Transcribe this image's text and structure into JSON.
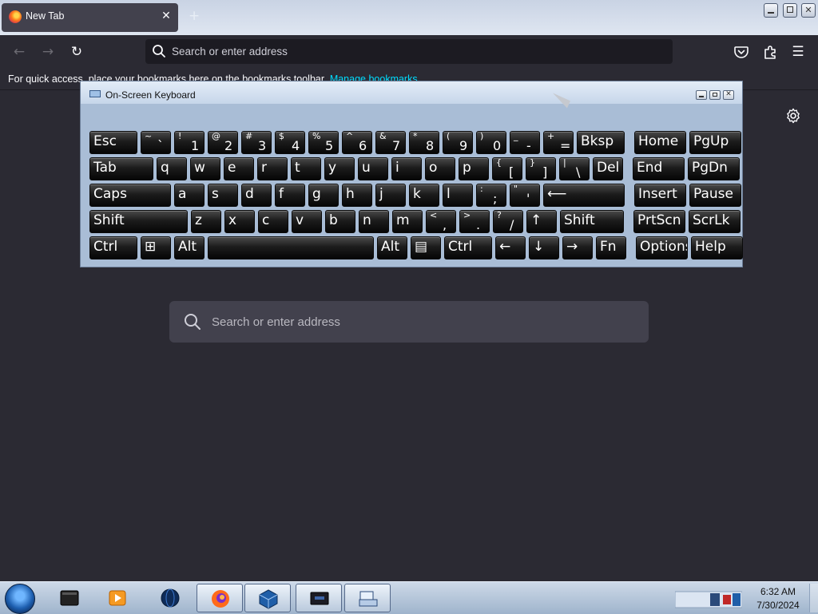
{
  "browser": {
    "tab_title": "New Tab",
    "tab_close_glyph": "✕",
    "new_tab_glyph": "+",
    "url_placeholder": "Search or enter address",
    "bookmarks_prompt": "For quick access, place your bookmarks here on the bookmarks toolbar.",
    "bookmarks_link": "Manage bookmarks",
    "back_glyph": "←",
    "forward_glyph": "→",
    "reload_glyph": "↻",
    "menu_glyph": "☰",
    "content_search_placeholder": "Search or enter address",
    "colors": {
      "background": "#2b2a33",
      "urlbar": "#1c1b22",
      "accent_link": "#00ddff"
    }
  },
  "osk": {
    "title": "On-Screen Keyboard",
    "rows": [
      [
        {
          "label": "Esc"
        },
        {
          "sub": "~",
          "main": "`"
        },
        {
          "sub": "!",
          "main": "1"
        },
        {
          "sub": "@",
          "main": "2"
        },
        {
          "sub": "#",
          "main": "3"
        },
        {
          "sub": "$",
          "main": "4"
        },
        {
          "sub": "%",
          "main": "5"
        },
        {
          "sub": "^",
          "main": "6"
        },
        {
          "sub": "&",
          "main": "7"
        },
        {
          "sub": "*",
          "main": "8"
        },
        {
          "sub": "(",
          "main": "9"
        },
        {
          "sub": ")",
          "main": "0"
        },
        {
          "sub": "_",
          "main": "-"
        },
        {
          "sub": "+",
          "main": "="
        },
        {
          "label": "Bksp"
        },
        {
          "label": "Home"
        },
        {
          "label": "PgUp"
        }
      ],
      [
        {
          "label": "Tab"
        },
        {
          "label": "q"
        },
        {
          "label": "w"
        },
        {
          "label": "e"
        },
        {
          "label": "r"
        },
        {
          "label": "t"
        },
        {
          "label": "y"
        },
        {
          "label": "u"
        },
        {
          "label": "i"
        },
        {
          "label": "o"
        },
        {
          "label": "p"
        },
        {
          "sub": "{",
          "main": "["
        },
        {
          "sub": "}",
          "main": "]"
        },
        {
          "sub": "|",
          "main": "\\"
        },
        {
          "label": "Del"
        },
        {
          "label": "End"
        },
        {
          "label": "PgDn"
        }
      ],
      [
        {
          "label": "Caps"
        },
        {
          "label": "a"
        },
        {
          "label": "s"
        },
        {
          "label": "d"
        },
        {
          "label": "f"
        },
        {
          "label": "g"
        },
        {
          "label": "h"
        },
        {
          "label": "j"
        },
        {
          "label": "k"
        },
        {
          "label": "l"
        },
        {
          "sub": ":",
          "main": ";"
        },
        {
          "sub": "\"",
          "main": "'"
        },
        {
          "label": "⟵"
        },
        {
          "label": "Insert"
        },
        {
          "label": "Pause"
        }
      ],
      [
        {
          "label": "Shift"
        },
        {
          "label": "z"
        },
        {
          "label": "x"
        },
        {
          "label": "c"
        },
        {
          "label": "v"
        },
        {
          "label": "b"
        },
        {
          "label": "n"
        },
        {
          "label": "m"
        },
        {
          "sub": "<",
          "main": ","
        },
        {
          "sub": ">",
          "main": "."
        },
        {
          "sub": "?",
          "main": "/"
        },
        {
          "label": "↑"
        },
        {
          "label": "Shift"
        },
        {
          "label": "PrtScn"
        },
        {
          "label": "ScrLk"
        }
      ],
      [
        {
          "label": "Ctrl"
        },
        {
          "label": "⊞"
        },
        {
          "label": "Alt"
        },
        {
          "label": ""
        },
        {
          "label": "Alt"
        },
        {
          "label": "▤"
        },
        {
          "label": "Ctrl"
        },
        {
          "label": "←"
        },
        {
          "label": "↓"
        },
        {
          "label": "→"
        },
        {
          "label": "Fn"
        },
        {
          "label": "Options"
        },
        {
          "label": "Help"
        }
      ]
    ]
  },
  "taskbar": {
    "clock_time": "6:32 AM",
    "clock_date": "7/30/2024",
    "items": [
      "on-screen-keyboard",
      "terminal",
      "media-player",
      "globe",
      "firefox",
      "virtualbox",
      "display",
      "keyboard-app"
    ]
  }
}
